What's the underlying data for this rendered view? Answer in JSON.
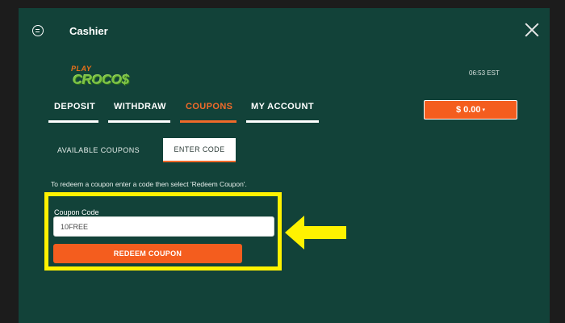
{
  "header": {
    "title": "Cashier",
    "menu_icon": "menu-circle-icon",
    "close_icon": "close-icon"
  },
  "logo": {
    "play": "PLAY",
    "croco": "CROCO$"
  },
  "time": "06:53 EST",
  "tabs": [
    {
      "label": "DEPOSIT",
      "active": false
    },
    {
      "label": "WITHDRAW",
      "active": false
    },
    {
      "label": "COUPONS",
      "active": true
    },
    {
      "label": "MY ACCOUNT",
      "active": false
    }
  ],
  "balance": "$ 0.00",
  "subtabs": [
    {
      "label": "AVAILABLE COUPONS",
      "active": false
    },
    {
      "label": "ENTER CODE",
      "active": true
    }
  ],
  "coupon": {
    "instructions": "To redeem a coupon enter a code then select 'Redeem Coupon'.",
    "label": "Coupon Code",
    "value": "10FREE",
    "button": "REDEEM COUPON"
  },
  "colors": {
    "background": "#124239",
    "accent": "#f45d1e",
    "highlight": "#fff200"
  }
}
